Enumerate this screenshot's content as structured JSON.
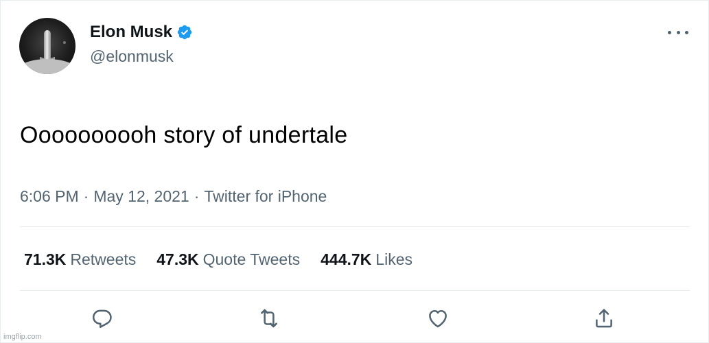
{
  "tweet": {
    "display_name": "Elon Musk",
    "handle": "@elonmusk",
    "verified": true,
    "text": "Oooooooooh story of undertale",
    "time": "6:06 PM",
    "separator": "·",
    "date": "May 12, 2021",
    "source": "Twitter for iPhone"
  },
  "stats": [
    {
      "count": "71.3K",
      "label": "Retweets"
    },
    {
      "count": "47.3K",
      "label": "Quote Tweets"
    },
    {
      "count": "444.7K",
      "label": "Likes"
    }
  ],
  "actions": {
    "reply_icon": "reply-icon",
    "retweet_icon": "retweet-icon",
    "like_icon": "heart-icon",
    "share_icon": "share-icon"
  },
  "watermark": "imgflip.com",
  "colors": {
    "verified_blue": "#1d9bf0",
    "muted_text": "#536471",
    "primary_text": "#0f1419",
    "divider": "#e6ecf0"
  }
}
